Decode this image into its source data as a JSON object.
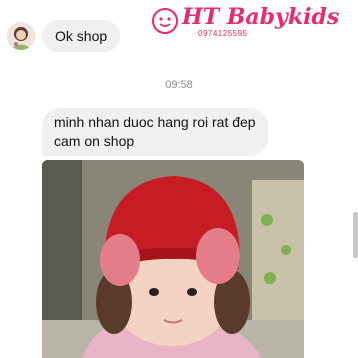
{
  "conversation": {
    "messages": [
      {
        "text": "Ok shop"
      }
    ],
    "timestamp": "09:58",
    "reply": {
      "line1": "minh nhan duoc hang roi rat đep",
      "line2": "cam on shop"
    },
    "photo": {
      "watermark_brand": "HT Babykids",
      "watermark_phone": "0974125595"
    }
  },
  "icons": {
    "avatar": "user-avatar",
    "photo_logo": "babykids-logo-icon"
  },
  "colors": {
    "bubble_bg": "#f0f0f0",
    "watermark": "#e62c6e",
    "hat": "#c71c24"
  }
}
